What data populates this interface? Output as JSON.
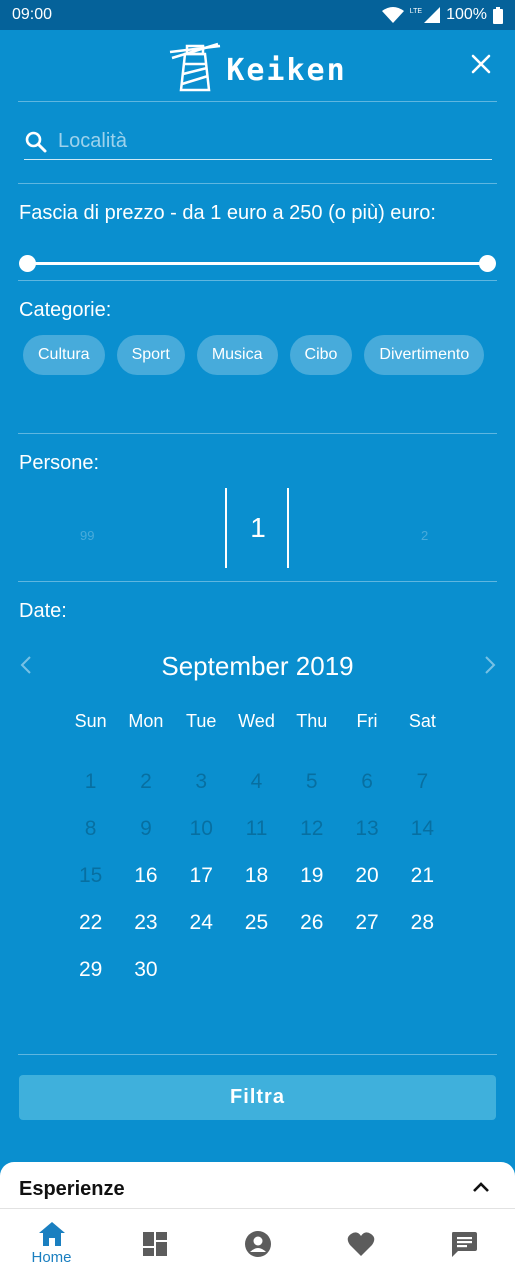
{
  "status_bar": {
    "time": "09:00",
    "battery": "100%",
    "network": "LTE"
  },
  "header": {
    "app_name": "Keiken"
  },
  "search": {
    "placeholder": "Località"
  },
  "price": {
    "label": "Fascia di prezzo - da 1 euro a 250 (o più) euro:",
    "min": 1,
    "max": 250
  },
  "categories": {
    "label": "Categorie:",
    "items": [
      "Cultura",
      "Sport",
      "Musica",
      "Cibo",
      "Divertimento"
    ]
  },
  "persons": {
    "label": "Persone:",
    "prev": "99",
    "value": "1",
    "next": "2"
  },
  "dates": {
    "label": "Date:",
    "month": "September 2019",
    "weekdays": [
      "Sun",
      "Mon",
      "Tue",
      "Wed",
      "Thu",
      "Fri",
      "Sat"
    ],
    "weeks": [
      [
        "1",
        "2",
        "3",
        "4",
        "5",
        "6",
        "7"
      ],
      [
        "8",
        "9",
        "10",
        "11",
        "12",
        "13",
        "14"
      ],
      [
        "15",
        "16",
        "17",
        "18",
        "19",
        "20",
        "21"
      ],
      [
        "22",
        "23",
        "24",
        "25",
        "26",
        "27",
        "28"
      ],
      [
        "29",
        "30",
        "",
        "",
        "",
        "",
        ""
      ]
    ],
    "first_available_day": 16
  },
  "filter_button": "Filtra",
  "bottom_sheet": {
    "title": "Esperienze"
  },
  "nav": {
    "items": [
      {
        "label": "Home",
        "icon": "home-icon",
        "active": true
      },
      {
        "label": "",
        "icon": "dashboard-icon",
        "active": false
      },
      {
        "label": "",
        "icon": "account-icon",
        "active": false
      },
      {
        "label": "",
        "icon": "heart-icon",
        "active": false
      },
      {
        "label": "",
        "icon": "chat-icon",
        "active": false
      }
    ]
  },
  "colors": {
    "primary": "#0a8fcf",
    "status_bar": "#05629a",
    "active_nav": "#1a7fc0",
    "nav_icon": "#5c5c5c"
  }
}
